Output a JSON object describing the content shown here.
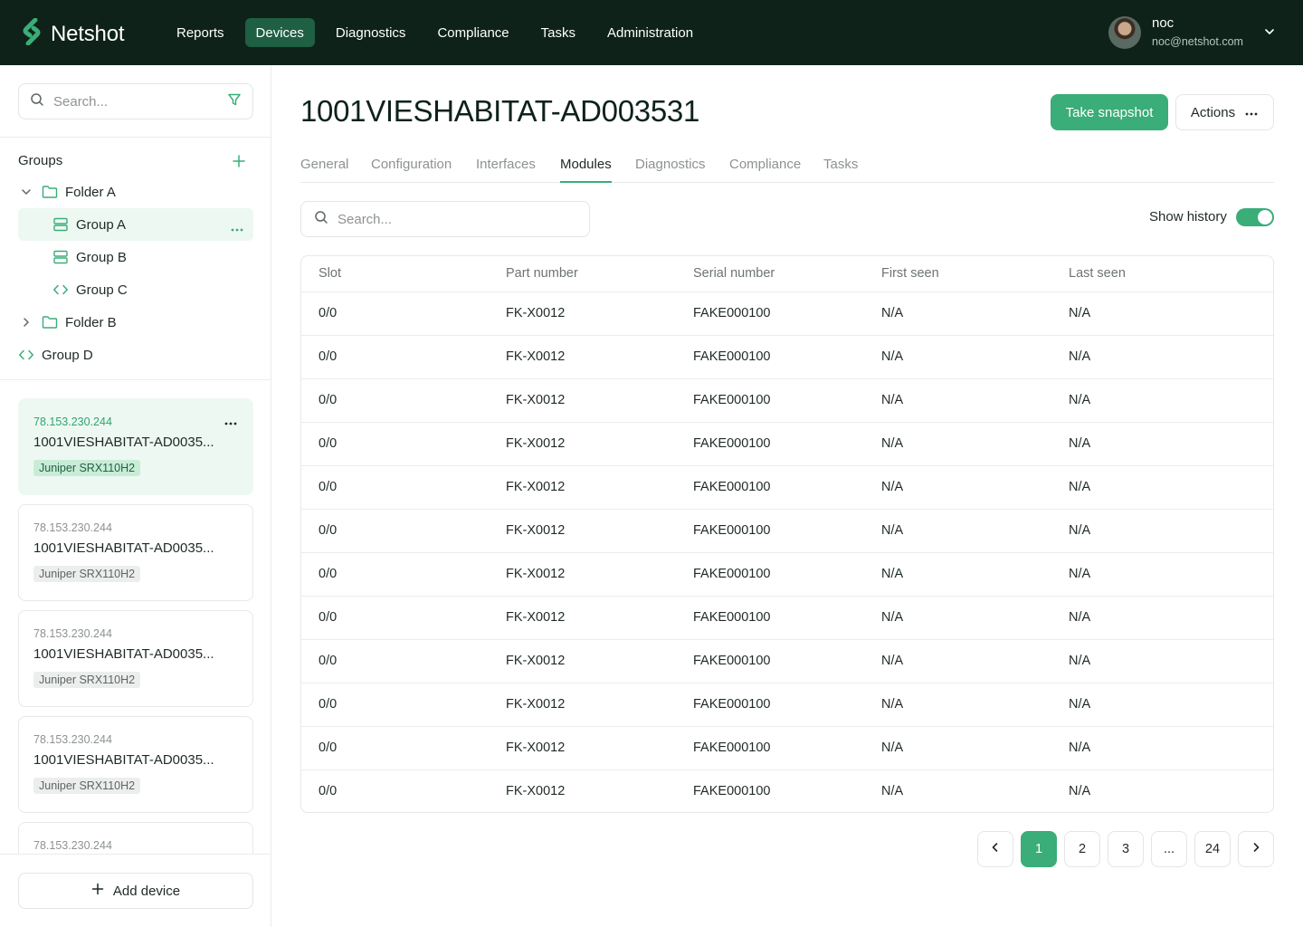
{
  "brand": {
    "name": "Netshot",
    "accent": "#3aad78",
    "dark": "#0e2219"
  },
  "nav": {
    "items": [
      "Reports",
      "Devices",
      "Diagnostics",
      "Compliance",
      "Tasks",
      "Administration"
    ],
    "active": "Devices"
  },
  "user": {
    "name": "noc",
    "email": "noc@netshot.com"
  },
  "sidebar": {
    "search_placeholder": "Search...",
    "groups_title": "Groups",
    "tree": [
      {
        "label": "Folder A",
        "type": "folder",
        "expanded": true
      },
      {
        "label": "Group A",
        "type": "static-group",
        "selected": true
      },
      {
        "label": "Group B",
        "type": "static-group"
      },
      {
        "label": "Group C",
        "type": "dynamic-group"
      },
      {
        "label": "Folder B",
        "type": "folder",
        "expanded": false
      },
      {
        "label": "Group D",
        "type": "dynamic-group"
      }
    ],
    "devices": [
      {
        "ip": "78.153.230.244",
        "name": "1001VIESHABITAT-AD0035...",
        "model": "Juniper SRX110H2",
        "selected": true
      },
      {
        "ip": "78.153.230.244",
        "name": "1001VIESHABITAT-AD0035...",
        "model": "Juniper SRX110H2"
      },
      {
        "ip": "78.153.230.244",
        "name": "1001VIESHABITAT-AD0035...",
        "model": "Juniper SRX110H2"
      },
      {
        "ip": "78.153.230.244",
        "name": "1001VIESHABITAT-AD0035...",
        "model": "Juniper SRX110H2"
      },
      {
        "ip": "78.153.230.244"
      }
    ],
    "add_device_label": "Add device"
  },
  "main": {
    "title": "1001VIESHABITAT-AD003531",
    "snapshot_label": "Take snapshot",
    "actions_label": "Actions",
    "tabs": [
      "General",
      "Configuration",
      "Interfaces",
      "Modules",
      "Diagnostics",
      "Compliance",
      "Tasks"
    ],
    "active_tab": "Modules",
    "search_placeholder": "Search...",
    "show_history_label": "Show history",
    "show_history_on": true,
    "table": {
      "columns": [
        "Slot",
        "Part number",
        "Serial number",
        "First seen",
        "Last seen"
      ],
      "rows": [
        [
          "0/0",
          "FK-X0012",
          "FAKE000100",
          "N/A",
          "N/A"
        ],
        [
          "0/0",
          "FK-X0012",
          "FAKE000100",
          "N/A",
          "N/A"
        ],
        [
          "0/0",
          "FK-X0012",
          "FAKE000100",
          "N/A",
          "N/A"
        ],
        [
          "0/0",
          "FK-X0012",
          "FAKE000100",
          "N/A",
          "N/A"
        ],
        [
          "0/0",
          "FK-X0012",
          "FAKE000100",
          "N/A",
          "N/A"
        ],
        [
          "0/0",
          "FK-X0012",
          "FAKE000100",
          "N/A",
          "N/A"
        ],
        [
          "0/0",
          "FK-X0012",
          "FAKE000100",
          "N/A",
          "N/A"
        ],
        [
          "0/0",
          "FK-X0012",
          "FAKE000100",
          "N/A",
          "N/A"
        ],
        [
          "0/0",
          "FK-X0012",
          "FAKE000100",
          "N/A",
          "N/A"
        ],
        [
          "0/0",
          "FK-X0012",
          "FAKE000100",
          "N/A",
          "N/A"
        ],
        [
          "0/0",
          "FK-X0012",
          "FAKE000100",
          "N/A",
          "N/A"
        ],
        [
          "0/0",
          "FK-X0012",
          "FAKE000100",
          "N/A",
          "N/A"
        ]
      ]
    },
    "pagination": {
      "pages": [
        "1",
        "2",
        "3",
        "...",
        "24"
      ],
      "current": "1"
    }
  }
}
